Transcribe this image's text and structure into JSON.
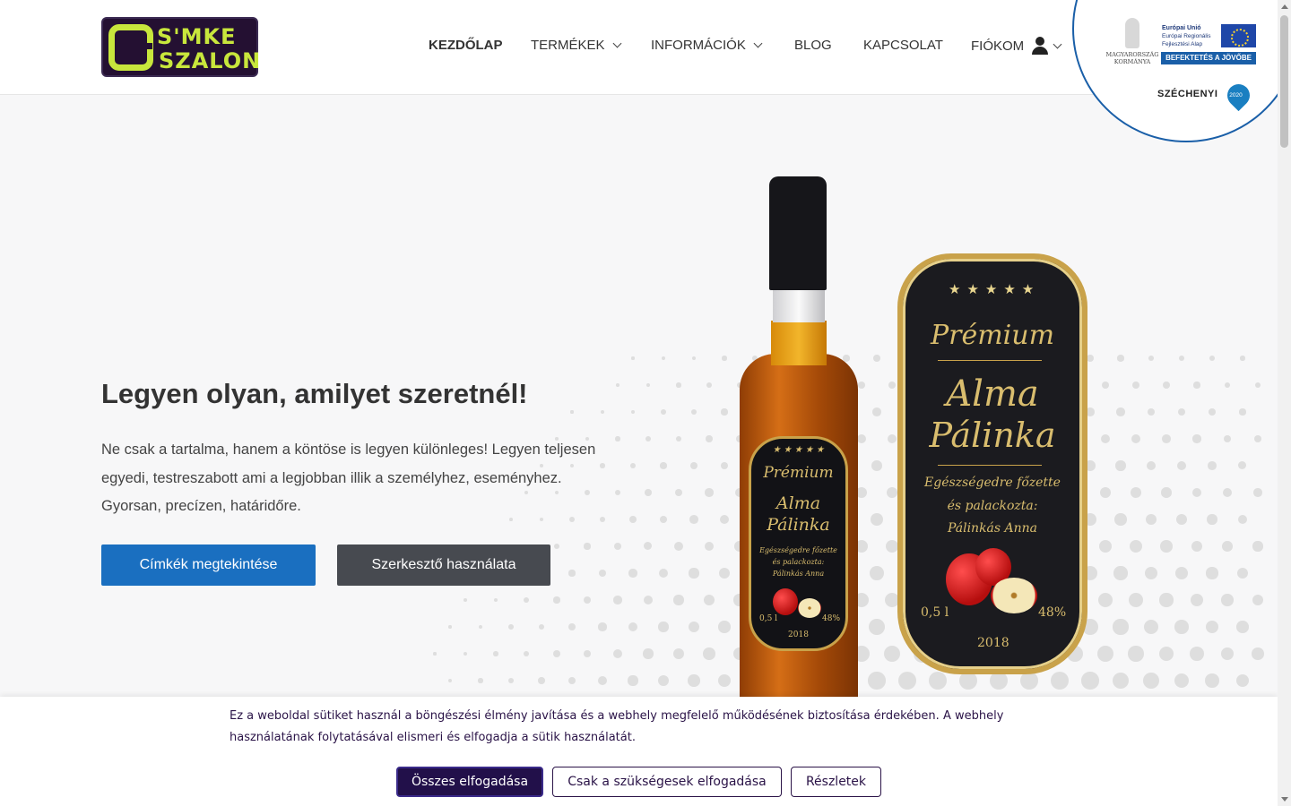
{
  "logo": {
    "line1": "S'MKE",
    "line2": "SZALON"
  },
  "nav": {
    "items": [
      {
        "label": "KEZDŐLAP"
      },
      {
        "label": "TERMÉKEK"
      },
      {
        "label": "INFORMÁCIÓK"
      },
      {
        "label": "BLOG"
      },
      {
        "label": "KAPCSOLAT"
      },
      {
        "label": "FIÓKOM"
      }
    ]
  },
  "badge": {
    "gov_line1": "MAGYARORSZÁG",
    "gov_line2": "KORMÁNYA",
    "eu_line1": "Európai Unió",
    "eu_line2": "Európai Regionális",
    "eu_line3": "Fejlesztési Alap",
    "invest": "BEFEKTETÉS A JÖVŐBE",
    "szechenyi": "SZÉCHENYI",
    "year": "2020"
  },
  "hero": {
    "title": "Legyen olyan, amilyet szeretnél!",
    "text": "Ne csak a tartalma, hanem a köntöse is legyen különleges! Legyen teljesen egyedi, testreszabott ami a legjobban illik a személyhez, eseményhez. Gyorsan, precízen, határidőre.",
    "btn_primary": "Címkék megtekintése",
    "btn_secondary": "Szerkesztő használata"
  },
  "label": {
    "premium": "Prémium",
    "name1": "Alma",
    "name2": "Pálinka",
    "sub1": "Egészségedre főzette",
    "sub2": "és palackozta:",
    "sub3": "Pálinkás Anna",
    "volume": "0,5 l",
    "abv": "48%",
    "year": "2018"
  },
  "cookie": {
    "text": "Ez a weboldal sütiket használ a böngészési élmény javítása és a webhely megfelelő működésének biztosítása érdekében. A webhely használatának folytatásával elismeri és elfogadja a sütik használatát.",
    "accept_all": "Összes elfogadása",
    "accept_necessary": "Csak a szükségesek elfogadása",
    "details": "Részletek"
  },
  "colors": {
    "primary": "#1a6fc0",
    "dark_button": "#474a50",
    "cookie_accent": "#22104a",
    "logo_green": "#c8e63c",
    "badge_blue": "#1a5fa8"
  },
  "icons": {
    "account": "user-icon",
    "dropdown": "chevron-down-icon"
  }
}
